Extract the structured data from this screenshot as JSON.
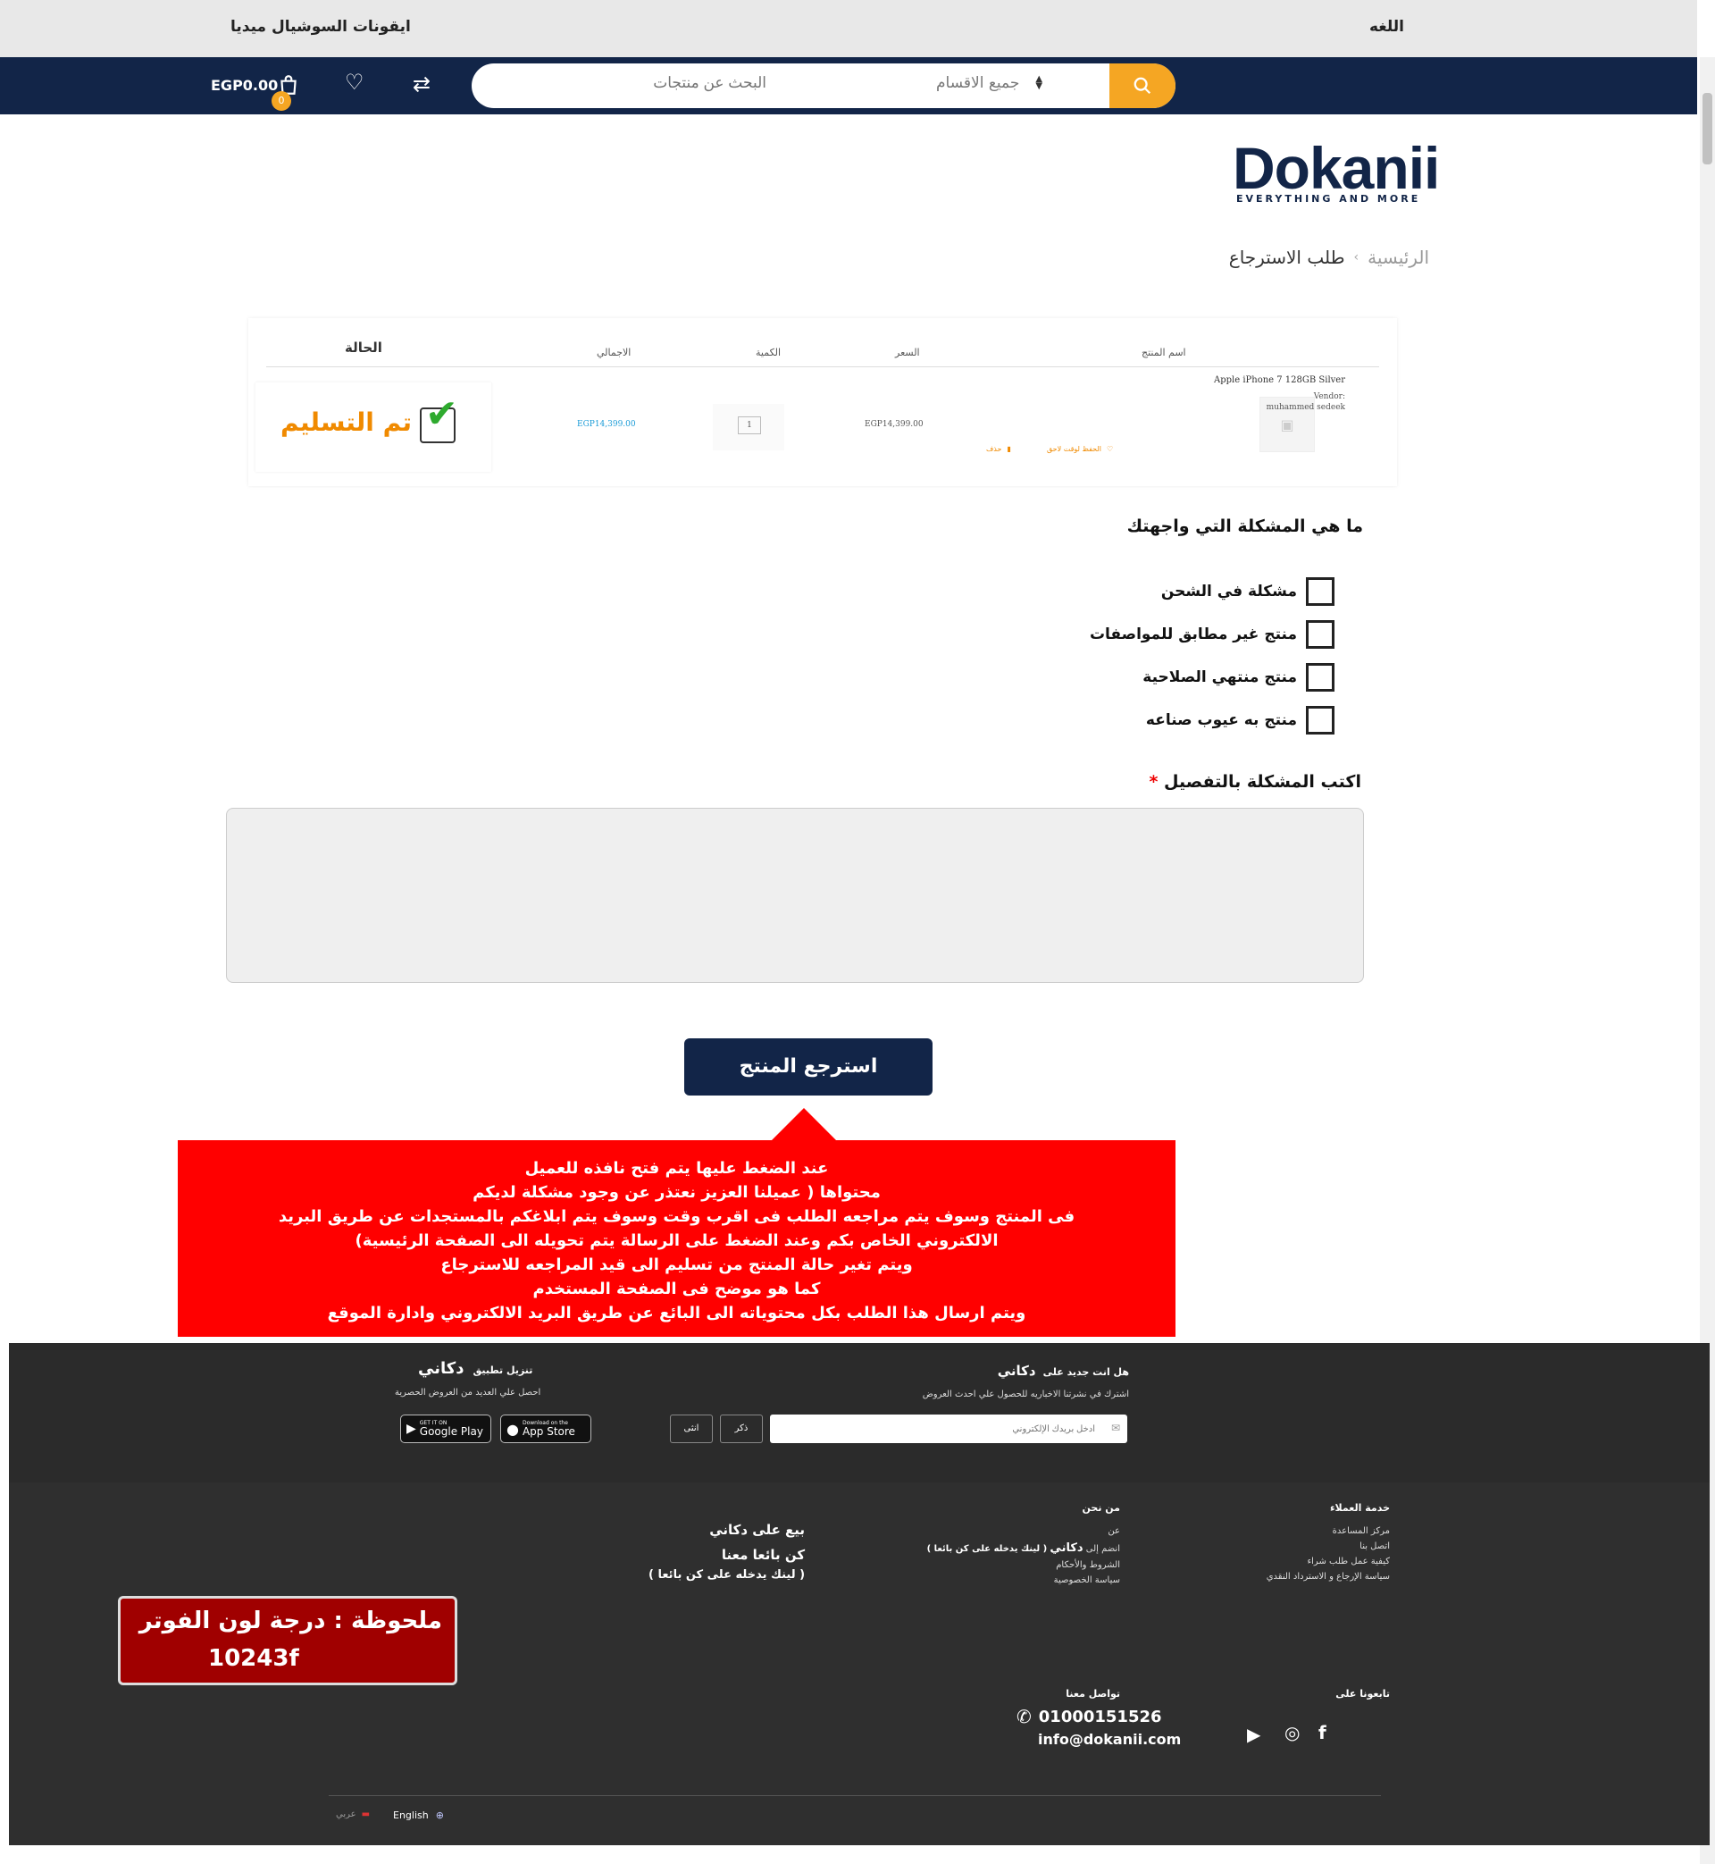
{
  "topbar": {
    "language_label": "اللغه",
    "social_label": "ايقونات السوشيال ميديا"
  },
  "nav": {
    "search_placeholder": "البحث عن منتجات",
    "category": "جميع الاقسام",
    "cart_total": "EGP0.00",
    "cart_count": "0",
    "icons": [
      "search-icon",
      "compare-icon",
      "heart-icon",
      "cart-icon"
    ]
  },
  "logo": {
    "name": "Dokanii",
    "tagline": "EVERYTHING AND MORE"
  },
  "breadcrumb": {
    "home": "الرئيسية",
    "separator": "›",
    "current": "طلب الاسترجاع"
  },
  "table": {
    "headers": {
      "product": "اسم المنتج",
      "price": "السعر",
      "qty": "الكمية",
      "total": "الاجمالي",
      "status": "الحالة"
    },
    "row": {
      "name": "Apple iPhone 7 128GB Silver",
      "vendor_label": "Vendor:",
      "vendor": "muhammed sedeek",
      "price": "EGP14,399.00",
      "qty": "1",
      "total": "EGP14,399.00",
      "save_later": "الحفظ لوقت لاحق",
      "delete": "حذف",
      "status": "تم التسليم"
    }
  },
  "problem": {
    "question": "ما هي المشكلة التي واجهتك",
    "options": [
      "مشكلة في الشحن",
      "منتج غير مطابق للمواصفات",
      "منتج منتهي الصلاحية",
      "منتج به عيوب صناعه"
    ],
    "details_label": "اكتب المشكلة بالتفصيل",
    "required_mark": "*"
  },
  "return_button": "استرجع المنتج",
  "red_note": [
    "عند الضغط عليها يتم فتح نافذه للعميل",
    "محتواها ( عميلنا العزيز نعتذر عن وجود مشكلة لديكم",
    "فى المنتج وسوف يتم مراجعه الطلب فى اقرب وقت وسوف يتم ابلاغكم بالمستجدات عن طريق البريد",
    "الالكتروني الخاص بكم وعند الضغط على الرسالة يتم تحويله الى الصفحة الرئيسية)",
    "ويتم تغير حالة المنتج من تسليم الى قيد المراجعه للاسترجاع",
    "كما هو موضح فى الصفحة المستخدم",
    "ويتم ارسال هذا الطلب بكل محتوياته الى البائع عن طريق البريد الالكتروني وادارة الموقع"
  ],
  "footer": {
    "newsletter_title": "هل انت جديد على",
    "brand": "دكاني",
    "newsletter_sub": "اشترك في نشرتنا الاخباريه للحصول علي احدث العروض",
    "email_placeholder": "أدخل بريدك الإلكتروني",
    "male": "ذكر",
    "female": "انثى",
    "app_title": "تنزيل تطبيق",
    "app_sub": "احصل علي العديد من العروض الحصرية",
    "appstore_small": "Download on the",
    "appstore": "App Store",
    "googleplay_small": "GET IT ON",
    "googleplay": "Google Play",
    "customer_service": {
      "title": "خدمة العملاء",
      "links": [
        "مركز المساعدة",
        "اتصل بنا",
        "كيفية عمل طلب شراء",
        "سياسة الإرجاع و الاسترداد النقدي"
      ]
    },
    "about": {
      "title": "من نحن",
      "links": [
        "عن",
        "انضم إلى",
        "( لينك يدخله على كن بائعا )",
        "الشروط والأحكام",
        "سياسة الخصوصية"
      ]
    },
    "sell": [
      "بيع على دكاني",
      "كن بائعا معنا",
      "( لينك يدخله على كن بائعا )"
    ],
    "follow_title": "تابعونا على",
    "contact_title": "تواصل معنا",
    "phone": "01000151526",
    "email": "info@dokanii.com",
    "lang_en": "English",
    "lang_ar": "عربي"
  },
  "maroon_note": {
    "line1": "ملحوظة : درجة لون الفوتر",
    "line2": "10243f"
  },
  "colors": {
    "navy": "#122548",
    "orange": "#f5a623",
    "footer": "#2f2f2f",
    "note_red": "#ff0000",
    "note_maroon": "#a00000"
  }
}
